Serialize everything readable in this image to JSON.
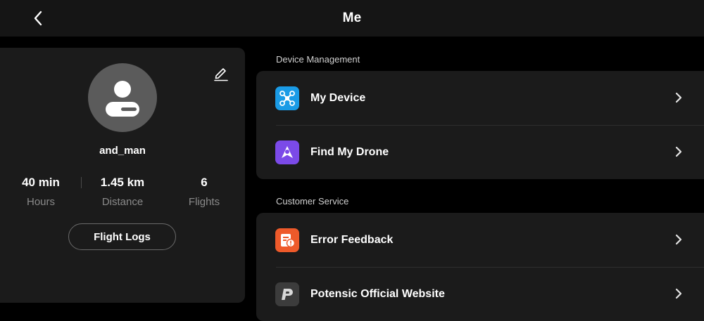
{
  "header": {
    "title": "Me"
  },
  "profile": {
    "username": "and_man",
    "stats": [
      {
        "value": "40 min",
        "label": "Hours"
      },
      {
        "value": "1.45 km",
        "label": "Distance"
      },
      {
        "value": "6",
        "label": "Flights"
      }
    ],
    "flight_logs_label": "Flight Logs"
  },
  "device_management": {
    "title": "Device Management",
    "items": [
      {
        "label": "My Device",
        "icon": "drone-icon",
        "color": "#1a9be6"
      },
      {
        "label": "Find My Drone",
        "icon": "location-pin-icon",
        "color": "#7b4ae8"
      }
    ]
  },
  "customer_service": {
    "title": "Customer Service",
    "items": [
      {
        "label": "Error Feedback",
        "icon": "error-report-icon",
        "color": "#ee5a2a"
      },
      {
        "label": "Potensic Official Website",
        "icon": "potensic-logo-icon",
        "color": "#3c3c3c"
      }
    ]
  }
}
